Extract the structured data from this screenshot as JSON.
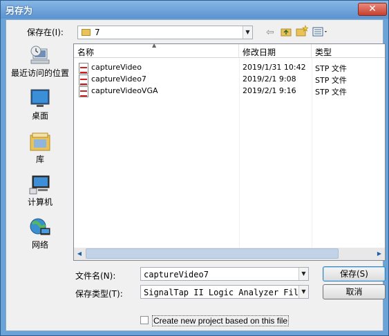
{
  "window": {
    "title": "另存为",
    "close_glyph": "✕"
  },
  "lookin": {
    "label": "保存在(I):",
    "value": "7"
  },
  "places": [
    {
      "name": "recent",
      "label": "最近访问的位置",
      "icon": "recent-places-icon"
    },
    {
      "name": "desktop",
      "label": "桌面",
      "icon": "desktop-icon"
    },
    {
      "name": "library",
      "label": "库",
      "icon": "library-icon"
    },
    {
      "name": "computer",
      "label": "计算机",
      "icon": "computer-icon"
    },
    {
      "name": "network",
      "label": "网络",
      "icon": "network-icon"
    }
  ],
  "columns": [
    "名称",
    "修改日期",
    "类型"
  ],
  "files": [
    {
      "name": "captureVideo",
      "date": "2019/1/31 10:42",
      "type": "STP 文件"
    },
    {
      "name": "captureVideo7",
      "date": "2019/2/1 9:08",
      "type": "STP 文件"
    },
    {
      "name": "captureVideoVGA",
      "date": "2019/2/1 9:16",
      "type": "STP 文件"
    }
  ],
  "form": {
    "filename_label": "文件名(N):",
    "filename_value": "captureVideo7",
    "filetype_label": "保存类型(T):",
    "filetype_value": "SignalTap II Logic Analyzer Files (*.stp)",
    "save_label": "保存(S)",
    "cancel_label": "取消",
    "checkbox_label": "Create new project based on this file"
  },
  "colors": {
    "accent": "#3c7fb1",
    "titlebar": "#6aa3d8",
    "close": "#c6402e"
  }
}
